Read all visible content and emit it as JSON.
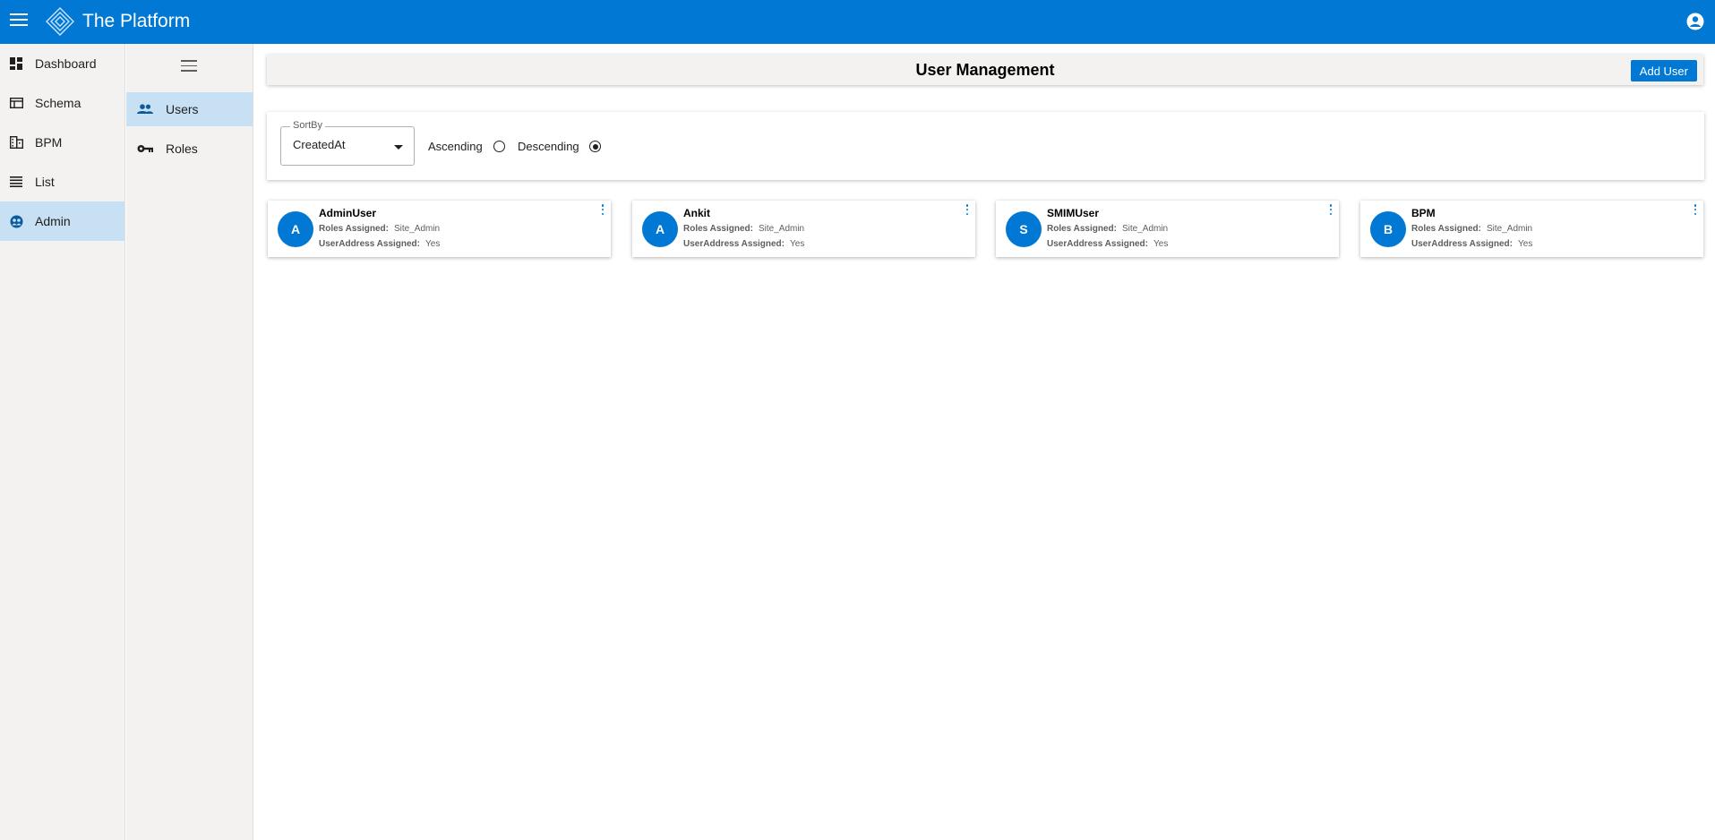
{
  "app": {
    "title": "The Platform"
  },
  "nav": {
    "items": [
      {
        "label": "Dashboard",
        "icon": "dashboard-icon"
      },
      {
        "label": "Schema",
        "icon": "schema-icon"
      },
      {
        "label": "BPM",
        "icon": "bpm-icon"
      },
      {
        "label": "List",
        "icon": "list-icon"
      },
      {
        "label": "Admin",
        "icon": "admin-icon",
        "active": true
      }
    ]
  },
  "subnav": {
    "items": [
      {
        "label": "Users",
        "icon": "people-icon",
        "active": true
      },
      {
        "label": "Roles",
        "icon": "key-icon"
      }
    ]
  },
  "page": {
    "title": "User Management",
    "add_user_label": "Add User"
  },
  "sort": {
    "legend": "SortBy",
    "value": "CreatedAt",
    "ascending_label": "Ascending",
    "descending_label": "Descending",
    "selected": "Descending"
  },
  "cards": [
    {
      "initial": "A",
      "name": "AdminUser",
      "roles_label": "Roles Assigned:",
      "roles_value": "Site_Admin",
      "address_label": "UserAddress Assigned:",
      "address_value": "Yes"
    },
    {
      "initial": "A",
      "name": "Ankit",
      "roles_label": "Roles Assigned:",
      "roles_value": "Site_Admin",
      "address_label": "UserAddress Assigned:",
      "address_value": "Yes"
    },
    {
      "initial": "S",
      "name": "SMIMUser",
      "roles_label": "Roles Assigned:",
      "roles_value": "Site_Admin",
      "address_label": "UserAddress Assigned:",
      "address_value": "Yes"
    },
    {
      "initial": "B",
      "name": "BPM",
      "roles_label": "Roles Assigned:",
      "roles_value": "Site_Admin",
      "address_label": "UserAddress Assigned:",
      "address_value": "Yes"
    }
  ],
  "colors": {
    "brand": "#0078d4",
    "nav_active": "#c7e0f4",
    "nav_bg": "#f3f2f1"
  }
}
